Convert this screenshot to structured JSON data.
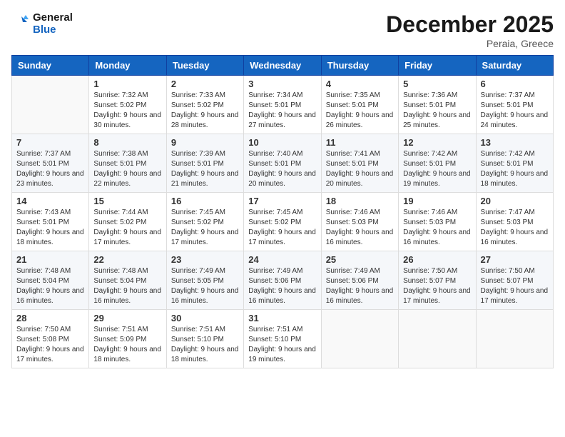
{
  "header": {
    "logo_line1": "General",
    "logo_line2": "Blue",
    "month_title": "December 2025",
    "location": "Peraia, Greece"
  },
  "weekdays": [
    "Sunday",
    "Monday",
    "Tuesday",
    "Wednesday",
    "Thursday",
    "Friday",
    "Saturday"
  ],
  "weeks": [
    [
      {
        "day": "",
        "sunrise": "",
        "sunset": "",
        "daylight": ""
      },
      {
        "day": "1",
        "sunrise": "7:32 AM",
        "sunset": "5:02 PM",
        "daylight": "9 hours and 30 minutes."
      },
      {
        "day": "2",
        "sunrise": "7:33 AM",
        "sunset": "5:02 PM",
        "daylight": "9 hours and 28 minutes."
      },
      {
        "day": "3",
        "sunrise": "7:34 AM",
        "sunset": "5:01 PM",
        "daylight": "9 hours and 27 minutes."
      },
      {
        "day": "4",
        "sunrise": "7:35 AM",
        "sunset": "5:01 PM",
        "daylight": "9 hours and 26 minutes."
      },
      {
        "day": "5",
        "sunrise": "7:36 AM",
        "sunset": "5:01 PM",
        "daylight": "9 hours and 25 minutes."
      },
      {
        "day": "6",
        "sunrise": "7:37 AM",
        "sunset": "5:01 PM",
        "daylight": "9 hours and 24 minutes."
      }
    ],
    [
      {
        "day": "7",
        "sunrise": "7:37 AM",
        "sunset": "5:01 PM",
        "daylight": "9 hours and 23 minutes."
      },
      {
        "day": "8",
        "sunrise": "7:38 AM",
        "sunset": "5:01 PM",
        "daylight": "9 hours and 22 minutes."
      },
      {
        "day": "9",
        "sunrise": "7:39 AM",
        "sunset": "5:01 PM",
        "daylight": "9 hours and 21 minutes."
      },
      {
        "day": "10",
        "sunrise": "7:40 AM",
        "sunset": "5:01 PM",
        "daylight": "9 hours and 20 minutes."
      },
      {
        "day": "11",
        "sunrise": "7:41 AM",
        "sunset": "5:01 PM",
        "daylight": "9 hours and 20 minutes."
      },
      {
        "day": "12",
        "sunrise": "7:42 AM",
        "sunset": "5:01 PM",
        "daylight": "9 hours and 19 minutes."
      },
      {
        "day": "13",
        "sunrise": "7:42 AM",
        "sunset": "5:01 PM",
        "daylight": "9 hours and 18 minutes."
      }
    ],
    [
      {
        "day": "14",
        "sunrise": "7:43 AM",
        "sunset": "5:01 PM",
        "daylight": "9 hours and 18 minutes."
      },
      {
        "day": "15",
        "sunrise": "7:44 AM",
        "sunset": "5:02 PM",
        "daylight": "9 hours and 17 minutes."
      },
      {
        "day": "16",
        "sunrise": "7:45 AM",
        "sunset": "5:02 PM",
        "daylight": "9 hours and 17 minutes."
      },
      {
        "day": "17",
        "sunrise": "7:45 AM",
        "sunset": "5:02 PM",
        "daylight": "9 hours and 17 minutes."
      },
      {
        "day": "18",
        "sunrise": "7:46 AM",
        "sunset": "5:03 PM",
        "daylight": "9 hours and 16 minutes."
      },
      {
        "day": "19",
        "sunrise": "7:46 AM",
        "sunset": "5:03 PM",
        "daylight": "9 hours and 16 minutes."
      },
      {
        "day": "20",
        "sunrise": "7:47 AM",
        "sunset": "5:03 PM",
        "daylight": "9 hours and 16 minutes."
      }
    ],
    [
      {
        "day": "21",
        "sunrise": "7:48 AM",
        "sunset": "5:04 PM",
        "daylight": "9 hours and 16 minutes."
      },
      {
        "day": "22",
        "sunrise": "7:48 AM",
        "sunset": "5:04 PM",
        "daylight": "9 hours and 16 minutes."
      },
      {
        "day": "23",
        "sunrise": "7:49 AM",
        "sunset": "5:05 PM",
        "daylight": "9 hours and 16 minutes."
      },
      {
        "day": "24",
        "sunrise": "7:49 AM",
        "sunset": "5:06 PM",
        "daylight": "9 hours and 16 minutes."
      },
      {
        "day": "25",
        "sunrise": "7:49 AM",
        "sunset": "5:06 PM",
        "daylight": "9 hours and 16 minutes."
      },
      {
        "day": "26",
        "sunrise": "7:50 AM",
        "sunset": "5:07 PM",
        "daylight": "9 hours and 17 minutes."
      },
      {
        "day": "27",
        "sunrise": "7:50 AM",
        "sunset": "5:07 PM",
        "daylight": "9 hours and 17 minutes."
      }
    ],
    [
      {
        "day": "28",
        "sunrise": "7:50 AM",
        "sunset": "5:08 PM",
        "daylight": "9 hours and 17 minutes."
      },
      {
        "day": "29",
        "sunrise": "7:51 AM",
        "sunset": "5:09 PM",
        "daylight": "9 hours and 18 minutes."
      },
      {
        "day": "30",
        "sunrise": "7:51 AM",
        "sunset": "5:10 PM",
        "daylight": "9 hours and 18 minutes."
      },
      {
        "day": "31",
        "sunrise": "7:51 AM",
        "sunset": "5:10 PM",
        "daylight": "9 hours and 19 minutes."
      },
      {
        "day": "",
        "sunrise": "",
        "sunset": "",
        "daylight": ""
      },
      {
        "day": "",
        "sunrise": "",
        "sunset": "",
        "daylight": ""
      },
      {
        "day": "",
        "sunrise": "",
        "sunset": "",
        "daylight": ""
      }
    ]
  ],
  "labels": {
    "sunrise": "Sunrise:",
    "sunset": "Sunset:",
    "daylight": "Daylight:"
  }
}
